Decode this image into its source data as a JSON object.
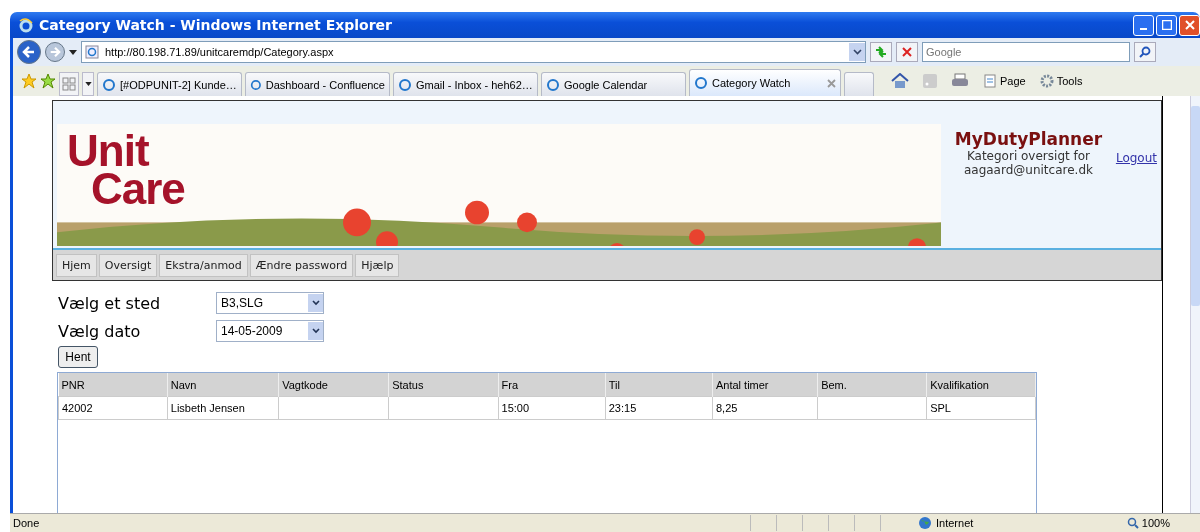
{
  "window": {
    "title": "Category Watch - Windows Internet Explorer"
  },
  "address": {
    "url": "http://80.198.71.89/unitcaremdp/Category.aspx"
  },
  "search": {
    "placeholder": "Google"
  },
  "tabs": [
    {
      "label": "[#ODPUNIT-2] Kunde…",
      "selected": false
    },
    {
      "label": "Dashboard - Confluence",
      "selected": false
    },
    {
      "label": "Gmail - Inbox - heh62…",
      "selected": false
    },
    {
      "label": "Google Calendar",
      "selected": false
    },
    {
      "label": "Category Watch",
      "selected": true
    }
  ],
  "command_bar": {
    "page": "Page",
    "tools": "Tools"
  },
  "header": {
    "logo": [
      "Unit",
      "Care"
    ],
    "app_name": "MyDutyPlanner",
    "subtitle": "Kategori oversigt for",
    "user": "aagaard@unitcare.dk",
    "logout": "Logout"
  },
  "nav": [
    "Hjem",
    "Oversigt",
    "Ekstra/anmod",
    "Ændre password",
    "Hjælp"
  ],
  "form": {
    "fields": [
      {
        "label": "Vælg et sted",
        "value": "B3,SLG"
      },
      {
        "label": "Vælg dato",
        "value": "14-05-2009"
      }
    ],
    "submit": "Hent"
  },
  "table": {
    "columns": [
      "PNR",
      "Navn",
      "Vagtkode",
      "Status",
      "Fra",
      "Til",
      "Antal timer",
      "Bem.",
      "Kvalifikation"
    ],
    "rows": [
      [
        "42002",
        "Lisbeth Jensen",
        "",
        "",
        "15:00",
        "23:15",
        "8,25",
        "",
        "SPL"
      ]
    ]
  },
  "status_bar": {
    "text": "Done",
    "zone": "Internet",
    "zoom": "100%"
  }
}
